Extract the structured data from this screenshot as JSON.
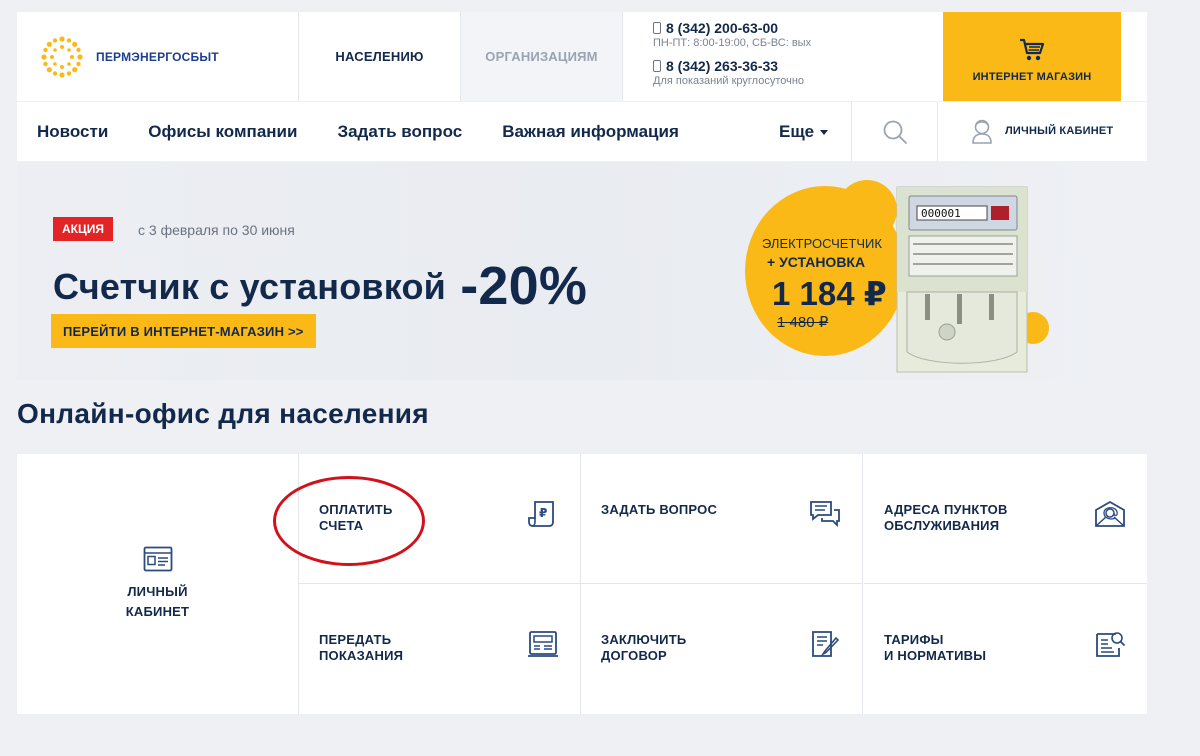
{
  "header": {
    "brand": "ПЕРМЭНЕРГОСБЫТ",
    "segments": {
      "population": "НАСЕЛЕНИЮ",
      "organizations": "ОРГАНИЗАЦИЯМ"
    },
    "phone1": {
      "number": "8 (342) 200-63-00",
      "note": "ПН-ПТ: 8:00-19:00, СБ-ВС: вых"
    },
    "phone2": {
      "number": "8 (342) 263-36-33",
      "note": "Для показаний круглосуточно"
    },
    "shop_label": "ИНТЕРНЕТ МАГАЗИН",
    "accent_color": "#fbb917"
  },
  "nav": {
    "items": [
      "Новости",
      "Офисы компании",
      "Задать вопрос",
      "Важная информация"
    ],
    "more_label": "Еще",
    "cabinet_label": "ЛИЧНЫЙ КАБИНЕТ"
  },
  "banner": {
    "badge": "АКЦИЯ",
    "badge_color": "#e32427",
    "dates": "с 3 февраля по 30 июня",
    "headline": "Счетчик с установкой",
    "discount": "-20%",
    "cta": "ПЕРЕЙТИ В ИНТЕРНЕТ-МАГАЗИН >>",
    "promo_line1": "ЭЛЕКТРОСЧЕТЧИК",
    "promo_line2": "+ УСТАНОВКА",
    "promo_price": "1 184 ₽",
    "promo_old_price": "1 480 ₽",
    "meter_display": "000001"
  },
  "section": {
    "title": "Онлайн-офис для населения",
    "cabinet": {
      "line1": "ЛИЧНЫЙ",
      "line2": "КАБИНЕТ"
    },
    "tiles": [
      {
        "line1": "ОПЛАТИТЬ",
        "line2": "СЧЕТА",
        "icon": "payment-receipt-icon"
      },
      {
        "line1": "ЗАДАТЬ ВОПРОС",
        "line2": "",
        "icon": "chat-icon"
      },
      {
        "line1": "АДРЕСА ПУНКТОВ",
        "line2": "ОБСЛУЖИВАНИЯ",
        "icon": "mail-at-icon"
      },
      {
        "line1": "ПЕРЕДАТЬ",
        "line2": "ПОКАЗАНИЯ",
        "icon": "meter-readings-icon"
      },
      {
        "line1": "ЗАКЛЮЧИТЬ",
        "line2": "ДОГОВОР",
        "icon": "contract-icon"
      },
      {
        "line1": "ТАРИФЫ",
        "line2": "И НОРМАТИВЫ",
        "icon": "tariffs-icon"
      }
    ]
  }
}
